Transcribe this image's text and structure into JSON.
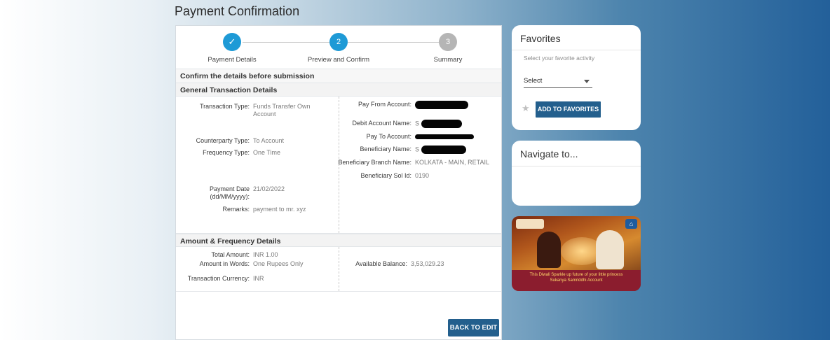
{
  "page_title": "Payment Confirmation",
  "stepper": [
    {
      "label": "Payment Details",
      "marker": "✓",
      "state": "done"
    },
    {
      "label": "Preview and Confirm",
      "marker": "2",
      "state": "active"
    },
    {
      "label": "Summary",
      "marker": "3",
      "state": "pending"
    }
  ],
  "confirm_heading": "Confirm the details before submission",
  "general": {
    "heading": "General Transaction Details",
    "transaction_type": {
      "label": "Transaction Type:",
      "value": "Funds Transfer Own Account"
    },
    "counterparty_type": {
      "label": "Counterparty Type:",
      "value": "To Account"
    },
    "frequency_type": {
      "label": "Frequency Type:",
      "value": "One Time"
    },
    "payment_date": {
      "label": "Payment Date (dd/MM/yyyy):",
      "value": "21/02/2022"
    },
    "remarks": {
      "label": "Remarks:",
      "value": "payment to mr. xyz"
    },
    "pay_from": {
      "label": "Pay From Account:",
      "value": ""
    },
    "debit_name": {
      "label": "Debit Account Name:",
      "value": "S"
    },
    "pay_to": {
      "label": "Pay To Account:",
      "value": ""
    },
    "beneficiary_name": {
      "label": "Beneficiary Name:",
      "value": "S"
    },
    "branch_name": {
      "label": "Beneficiary Branch Name:",
      "value": "KOLKATA - MAIN, RETAIL"
    },
    "sol_id": {
      "label": "Beneficiary Sol Id:",
      "value": "0190"
    }
  },
  "amount": {
    "heading": "Amount & Frequency Details",
    "total": {
      "label": "Total Amount:",
      "value": "INR 1.00"
    },
    "words": {
      "label": "Amount in Words:",
      "value": "One Rupees Only"
    },
    "currency": {
      "label": "Transaction Currency:",
      "value": "INR"
    },
    "balance": {
      "label": "Available Balance:",
      "value": "3,53,029.23"
    }
  },
  "back_button": "BACK TO EDIT",
  "favorites": {
    "title": "Favorites",
    "subtitle": "Select your favorite activity",
    "select_value": "Select",
    "add_button": "ADD TO FAVORITES"
  },
  "navigate": {
    "title": "Navigate to..."
  },
  "banner": {
    "line1": "This Diwali Sparkle up future of your little princess",
    "line2": "Sukanya Samriddhi Account"
  },
  "colors": {
    "primary_button": "#235f8d",
    "step_active": "#1e9ad6",
    "step_pending": "#b5b5b5"
  }
}
